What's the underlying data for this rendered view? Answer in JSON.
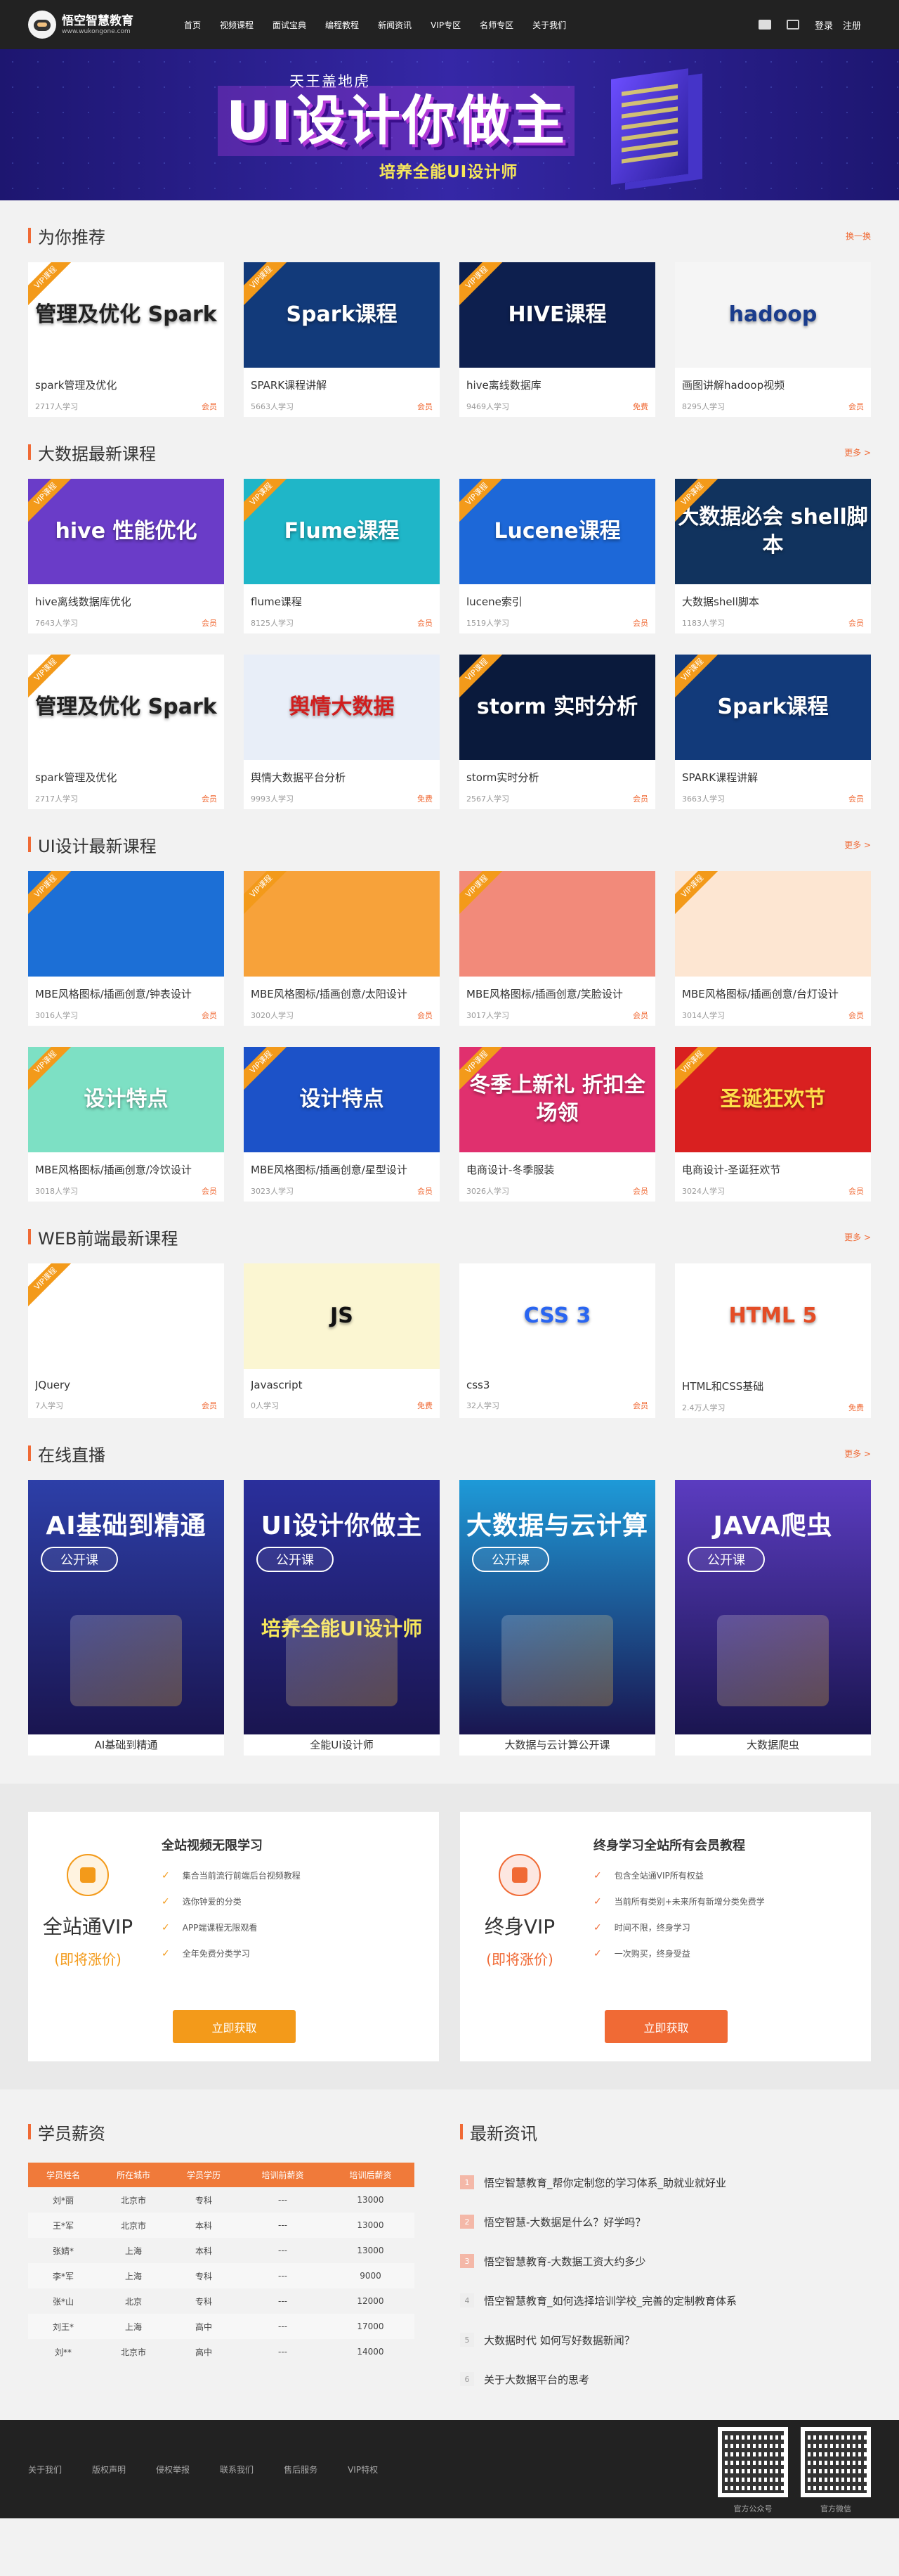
{
  "header": {
    "logo_title": "悟空智慧教育",
    "logo_url_text": "www.wukongone.com",
    "nav": [
      "首页",
      "视频课程",
      "面试宝典",
      "编程教程",
      "新闻资讯",
      "VIP专区",
      "名师专区",
      "关于我们"
    ],
    "login": "登录",
    "register": "注册"
  },
  "banner": {
    "small": "天王盖地虎",
    "big": "UI设计你做主",
    "sub": "培养全能UI设计师"
  },
  "recommend": {
    "title": "为你推荐",
    "action": "换一换",
    "cards": [
      {
        "thumb": "管理及优化 Spark",
        "title": "spark管理及优化",
        "learners": "2717人学习",
        "price": "会员",
        "vip": "VIP课程",
        "bg": "#ffffff",
        "fg": "#222222"
      },
      {
        "thumb": "Spark课程",
        "title": "SPARK课程讲解",
        "learners": "5663人学习",
        "price": "会员",
        "vip": "VIP课程",
        "bg": "#123a7a",
        "fg": "#ffffff"
      },
      {
        "thumb": "HIVE课程",
        "title": "hive离线数据库",
        "learners": "9469人学习",
        "price": "免费",
        "vip": "VIP课程",
        "bg": "#0d1f4e",
        "fg": "#ffffff"
      },
      {
        "thumb": "hadoop",
        "title": "画图讲解hadoop视频",
        "learners": "8295人学习",
        "price": "会员",
        "vip": "",
        "bg": "#f5f5f5",
        "fg": "#1a3c8c"
      }
    ]
  },
  "bigdata": {
    "title": "大数据最新课程",
    "more": "更多 >",
    "cards": [
      {
        "thumb": "hive 性能优化",
        "title": "hive离线数据库优化",
        "learners": "7643人学习",
        "price": "会员",
        "vip": "VIP课程",
        "bg": "#6a3cc8",
        "fg": "#ffffff"
      },
      {
        "thumb": "Flume课程",
        "title": "flume课程",
        "learners": "8125人学习",
        "price": "会员",
        "vip": "VIP课程",
        "bg": "#1fb6c8",
        "fg": "#ffffff"
      },
      {
        "thumb": "Lucene课程",
        "title": "lucene索引",
        "learners": "1519人学习",
        "price": "会员",
        "vip": "VIP课程",
        "bg": "#1d68d8",
        "fg": "#ffffff"
      },
      {
        "thumb": "大数据必会 shell脚本",
        "title": "大数据shell脚本",
        "learners": "1183人学习",
        "price": "会员",
        "vip": "VIP课程",
        "bg": "#11335e",
        "fg": "#ffffff"
      },
      {
        "thumb": "管理及优化 Spark",
        "title": "spark管理及优化",
        "learners": "2717人学习",
        "price": "会员",
        "vip": "VIP课程",
        "bg": "#ffffff",
        "fg": "#222222"
      },
      {
        "thumb": "舆情大数据",
        "title": "舆情大数据平台分析",
        "learners": "9993人学习",
        "price": "免费",
        "vip": "",
        "bg": "#e8eef8",
        "fg": "#d01e1e"
      },
      {
        "thumb": "storm 实时分析",
        "title": "storm实时分析",
        "learners": "2567人学习",
        "price": "会员",
        "vip": "VIP课程",
        "bg": "#0a1a3c",
        "fg": "#ffffff"
      },
      {
        "thumb": "Spark课程",
        "title": "SPARK课程讲解",
        "learners": "3663人学习",
        "price": "会员",
        "vip": "VIP课程",
        "bg": "#123a7a",
        "fg": "#ffffff"
      }
    ]
  },
  "ui": {
    "title": "UI设计最新课程",
    "more": "更多 >",
    "cards": [
      {
        "thumb": "",
        "title": "MBE风格图标/插画创意/钟表设计",
        "learners": "3016人学习",
        "price": "会员",
        "vip": "VIP课程",
        "bg": "#1c6fd6",
        "fg": "#ffffff"
      },
      {
        "thumb": "",
        "title": "MBE风格图标/插画创意/太阳设计",
        "learners": "3020人学习",
        "price": "会员",
        "vip": "VIP课程",
        "bg": "#f7a23a",
        "fg": "#ffffff"
      },
      {
        "thumb": "",
        "title": "MBE风格图标/插画创意/笑脸设计",
        "learners": "3017人学习",
        "price": "会员",
        "vip": "VIP课程",
        "bg": "#f28a7a",
        "fg": "#ffffff"
      },
      {
        "thumb": "",
        "title": "MBE风格图标/插画创意/台灯设计",
        "learners": "3014人学习",
        "price": "会员",
        "vip": "VIP课程",
        "bg": "#fde6d2",
        "fg": "#ffffff"
      },
      {
        "thumb": "设计特点",
        "title": "MBE风格图标/插画创意/冷饮设计",
        "learners": "3018人学习",
        "price": "会员",
        "vip": "VIP课程",
        "bg": "#7de0c4",
        "fg": "#ffffff"
      },
      {
        "thumb": "设计特点",
        "title": "MBE风格图标/插画创意/星型设计",
        "learners": "3023人学习",
        "price": "会员",
        "vip": "VIP课程",
        "bg": "#1c52c8",
        "fg": "#ffffff"
      },
      {
        "thumb": "冬季上新礼 折扣全场领",
        "title": "电商设计-冬季服装",
        "learners": "3026人学习",
        "price": "会员",
        "vip": "VIP课程",
        "bg": "#e0306e",
        "fg": "#ffffff"
      },
      {
        "thumb": "圣诞狂欢节",
        "title": "电商设计-圣诞狂欢节",
        "learners": "3024人学习",
        "price": "会员",
        "vip": "VIP课程",
        "bg": "#d92020",
        "fg": "#ffe04a"
      }
    ]
  },
  "web": {
    "title": "WEB前端最新课程",
    "more": "更多 >",
    "cards": [
      {
        "thumb": "",
        "title": "JQuery",
        "learners": "7人学习",
        "price": "会员",
        "vip": "VIP课程",
        "bg": "#ffffff",
        "fg": "#333333"
      },
      {
        "thumb": "JS",
        "title": "Javascript",
        "learners": "0人学习",
        "price": "免费",
        "vip": "",
        "bg": "#fbf6d2",
        "fg": "#111111"
      },
      {
        "thumb": "CSS 3",
        "title": "css3",
        "learners": "32人学习",
        "price": "会员",
        "vip": "",
        "bg": "#ffffff",
        "fg": "#2965f1"
      },
      {
        "thumb": "HTML 5",
        "title": "HTML和CSS基础",
        "learners": "2.4万人学习",
        "price": "免费",
        "vip": "",
        "bg": "#ffffff",
        "fg": "#e44d26"
      }
    ]
  },
  "live": {
    "title": "在线直播",
    "more": "更多 >",
    "items": [
      {
        "poster_title": "AI基础到精通",
        "pill": "公开课",
        "sub": "",
        "label": "AI基础到精通",
        "bg": "#2d3fa8"
      },
      {
        "poster_title": "UI设计你做主",
        "pill": "公开课",
        "sub": "培养全能UI设计师",
        "label": "全能UI设计师",
        "bg": "#2a2f9c"
      },
      {
        "poster_title": "大数据与云计算",
        "pill": "公开课",
        "sub": "",
        "label": "大数据与云计算公开课",
        "bg": "#1e9ad8"
      },
      {
        "poster_title": "JAVA爬虫",
        "pill": "公开课",
        "sub": "",
        "label": "大数据爬虫",
        "bg": "#5b3cc0"
      }
    ]
  },
  "vip": [
    {
      "name": "全站通VIP",
      "soon": "(即将涨价)",
      "heading": "全站视频无限学习",
      "features": [
        "集合当前流行前端后台视频教程",
        "选你钟爱的分类",
        "APP端课程无限观看",
        "全年免费分类学习"
      ],
      "button": "立即获取",
      "accent": "#f39a1a"
    },
    {
      "name": "终身VIP",
      "soon": "(即将涨价)",
      "heading": "终身学习全站所有会员教程",
      "features": [
        "包含全站通VIP所有权益",
        "当前所有类别+未来所有新增分类免费学",
        "时间不限，终身学习",
        "一次购买，终身受益"
      ],
      "button": "立即获取",
      "accent": "#f06a35"
    }
  ],
  "salary": {
    "title": "学员薪资",
    "columns": [
      "学员姓名",
      "所在城市",
      "学员学历",
      "培训前薪资",
      "培训后薪资"
    ],
    "rows": [
      [
        "刘*丽",
        "北京市",
        "专科",
        "---",
        "13000"
      ],
      [
        "王*军",
        "北京市",
        "本科",
        "---",
        "13000"
      ],
      [
        "张婧*",
        "上海",
        "本科",
        "---",
        "13000"
      ],
      [
        "李*军",
        "上海",
        "专科",
        "---",
        "9000"
      ],
      [
        "张*山",
        "北京",
        "专科",
        "---",
        "12000"
      ],
      [
        "刘王*",
        "上海",
        "高中",
        "---",
        "17000"
      ],
      [
        "刘**",
        "北京市",
        "高中",
        "---",
        "14000"
      ]
    ]
  },
  "news": {
    "title": "最新资讯",
    "items": [
      {
        "num": "1",
        "text": "悟空智慧教育_帮你定制您的学习体系_助就业就好业"
      },
      {
        "num": "2",
        "text": "悟空智慧-大数据是什么？好学吗？"
      },
      {
        "num": "3",
        "text": "悟空智慧教育-大数据工资大约多少"
      },
      {
        "num": "4",
        "text": "悟空智慧教育_如何选择培训学校_完善的定制教育体系"
      },
      {
        "num": "5",
        "text": "大数据时代 如何写好数据新闻？"
      },
      {
        "num": "6",
        "text": "关于大数据平台的思考"
      }
    ]
  },
  "footer": {
    "links": [
      "关于我们",
      "版权声明",
      "侵权举报",
      "联系我们",
      "售后服务",
      "VIP特权"
    ],
    "qr1": "官方公众号",
    "qr2": "官方微信"
  }
}
